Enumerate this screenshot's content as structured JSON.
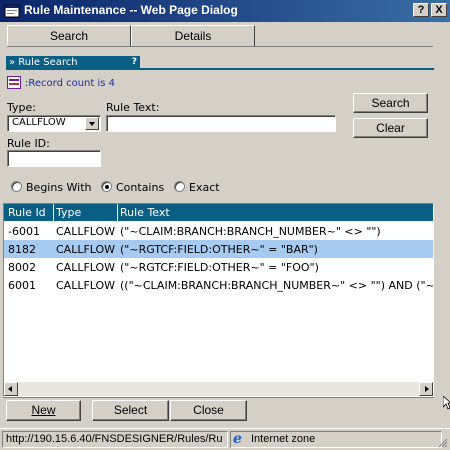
{
  "window": {
    "title": "Rule Maintenance -- Web Page Dialog",
    "help_btn": "?",
    "close_btn": "X"
  },
  "tabs": [
    {
      "label": "Search",
      "active": true
    },
    {
      "label": "Details",
      "active": false
    }
  ],
  "section": {
    "title": "» Rule Search",
    "help": "?"
  },
  "record_count": ":Record count is 4",
  "form": {
    "type_label": "Type:",
    "type_value": "CALLFLOW",
    "rule_text_label": "Rule Text:",
    "rule_text_value": "",
    "rule_id_label": "Rule ID:",
    "rule_id_value": "",
    "search_button": "Search",
    "clear_button": "Clear",
    "match_options": [
      {
        "label": "Begins With",
        "checked": false
      },
      {
        "label": "Contains",
        "checked": true
      },
      {
        "label": "Exact",
        "checked": false
      }
    ]
  },
  "grid": {
    "headers": [
      "Rule Id",
      "Type",
      "Rule Text"
    ],
    "rows": [
      {
        "id": "-6001",
        "type": "CALLFLOW",
        "text": "(\"~CLAIM:BRANCH:BRANCH_NUMBER~\" <> \"\")",
        "selected": false
      },
      {
        "id": "8182",
        "type": "CALLFLOW",
        "text": "(\"~RGTCF:FIELD:OTHER~\" = \"BAR\")",
        "selected": true
      },
      {
        "id": "8002",
        "type": "CALLFLOW",
        "text": "(\"~RGTCF:FIELD:OTHER~\" = \"FOO\")",
        "selected": false
      },
      {
        "id": "6001",
        "type": "CALLFLOW",
        "text": "((\"~CLAIM:BRANCH:BRANCH_NUMBER~\" <> \"\") AND (\"~C",
        "selected": false
      }
    ]
  },
  "footer": {
    "new_button": "New",
    "select_button": "Select",
    "close_button": "Close"
  },
  "status": {
    "url": "http://190.15.6.40/FNSDESIGNER/Rules/Ru",
    "zone": "Internet zone"
  },
  "colors": {
    "titlebar": "#0a246a",
    "header": "#0a5f84",
    "selection": "#a6caf0"
  }
}
